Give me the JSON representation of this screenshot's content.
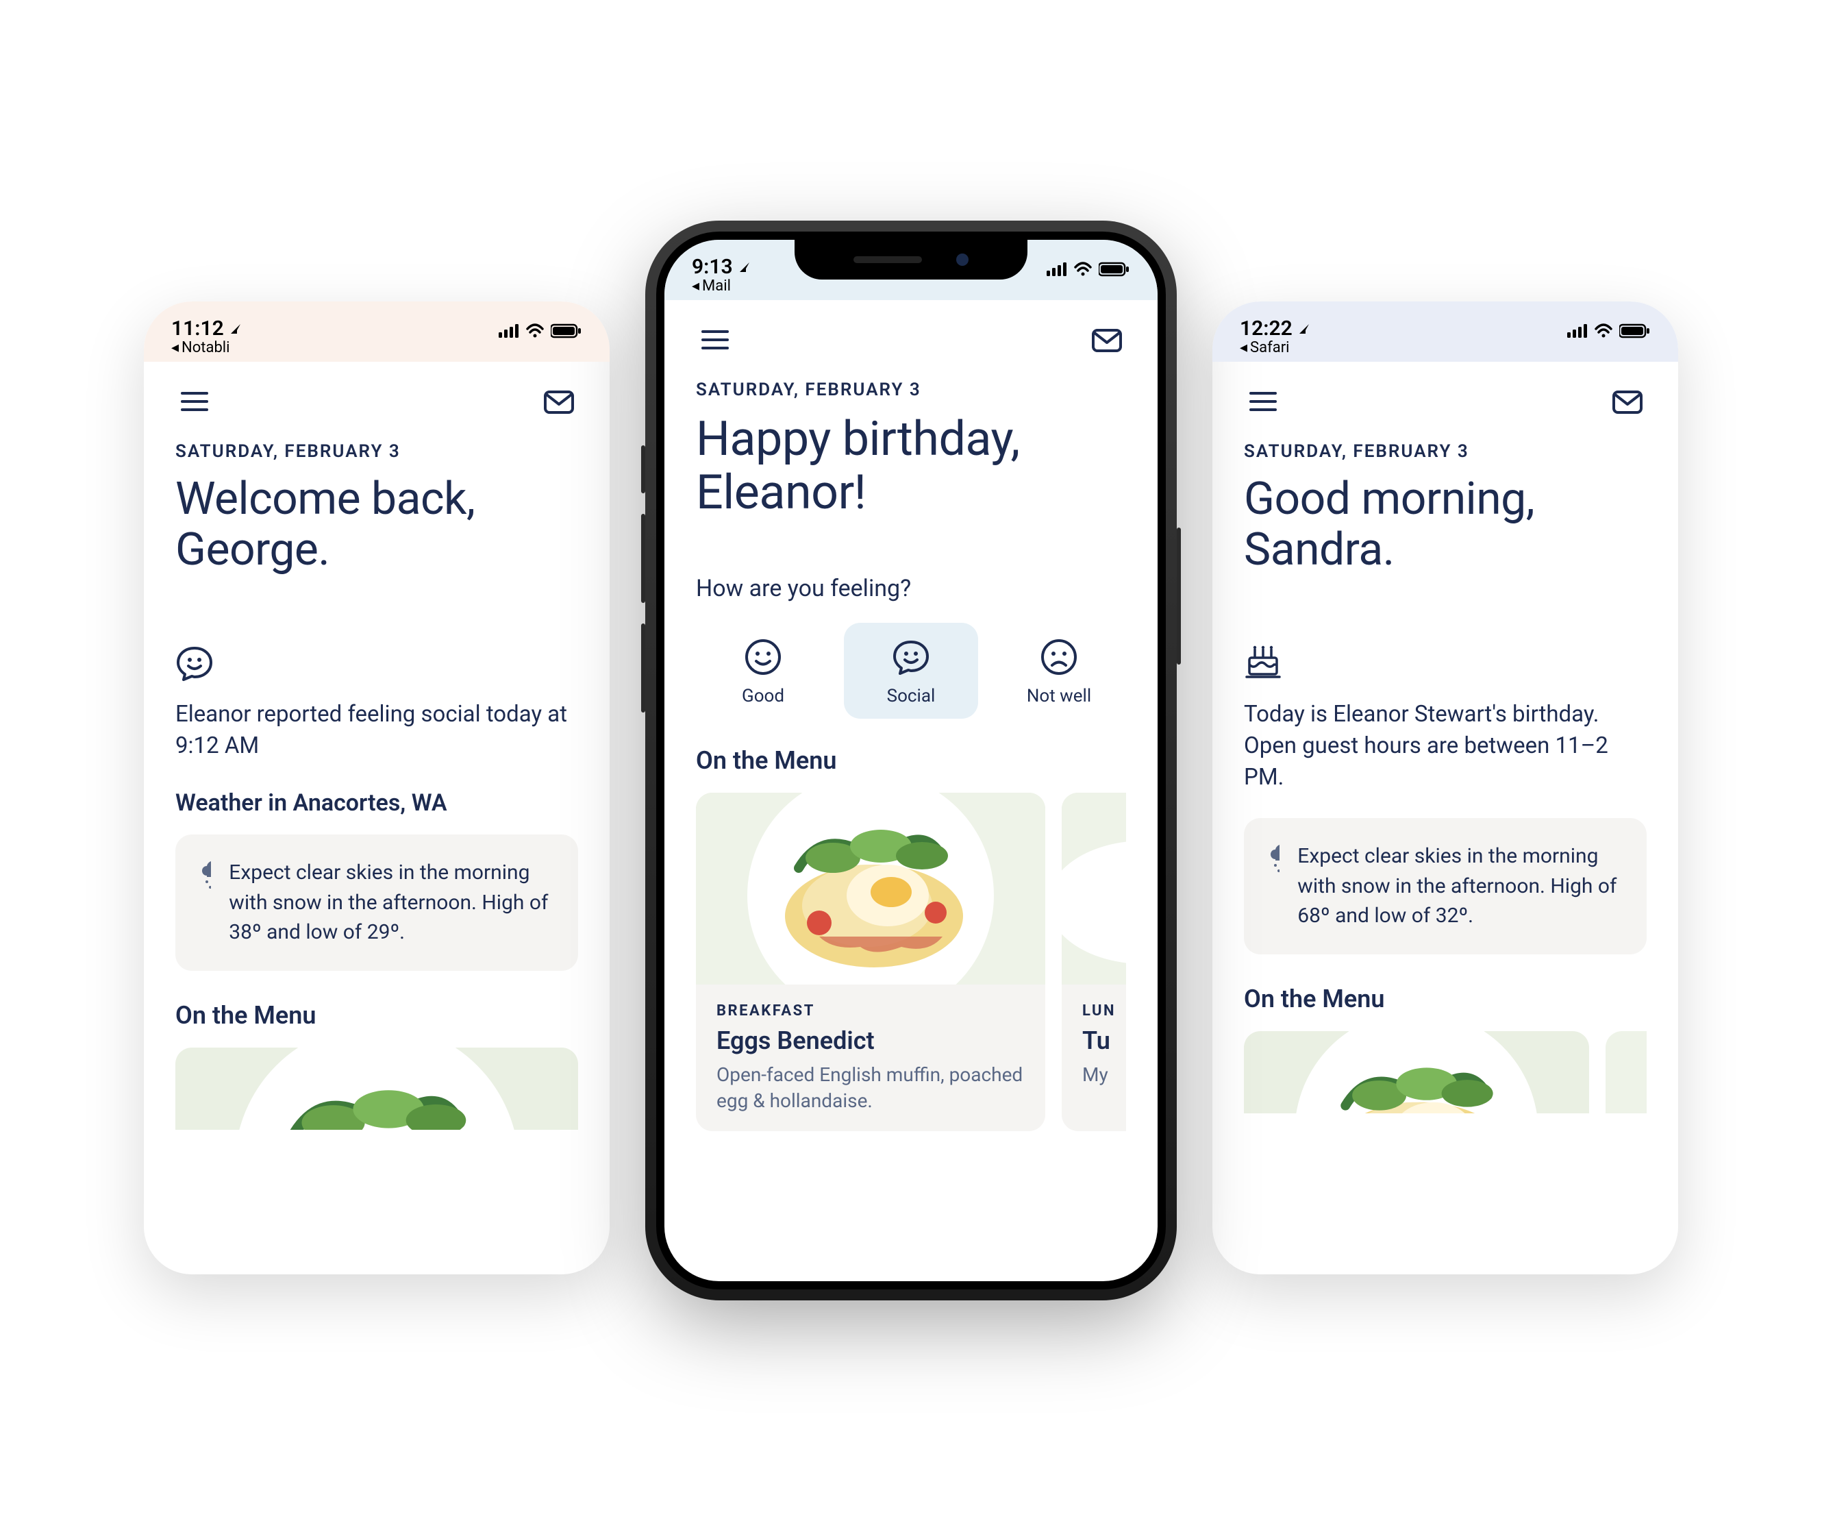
{
  "screens": {
    "left": {
      "status": {
        "time": "11:12",
        "back_app": "Notabli"
      },
      "header": {
        "bg_color": "#fbf1eb",
        "date": "SATURDAY, FEBRUARY 3",
        "greeting": "Welcome back, George."
      },
      "feeling_report": {
        "icon": "chat-smile-icon",
        "text": "Eleanor reported feeling social today at 9:12 AM"
      },
      "weather": {
        "title": "Weather in Anacortes, WA",
        "text": "Expect clear skies in the morning with snow in the afternoon. High of 38º and low of 29º."
      },
      "menu_title": "On the Menu"
    },
    "center": {
      "status": {
        "time": "9:13",
        "back_app": "Mail"
      },
      "header": {
        "bg_color": "#e6f0f6",
        "date": "SATURDAY, FEBRUARY 3",
        "greeting": "Happy birthday, Eleanor!"
      },
      "mood": {
        "question": "How are you feeling?",
        "options": [
          {
            "key": "good",
            "label": "Good",
            "icon": "smile-icon",
            "selected": false
          },
          {
            "key": "social",
            "label": "Social",
            "icon": "chat-smile-icon",
            "selected": true
          },
          {
            "key": "notwell",
            "label": "Not well",
            "icon": "frown-icon",
            "selected": false
          }
        ]
      },
      "menu": {
        "title": "On the Menu",
        "items": [
          {
            "tag": "BREAKFAST",
            "name": "Eggs Benedict",
            "desc": "Open-faced English muffin, poached egg & hollandaise."
          },
          {
            "tag": "LUN",
            "name": "Tu",
            "desc": "My"
          }
        ]
      }
    },
    "right": {
      "status": {
        "time": "12:22",
        "back_app": "Safari"
      },
      "header": {
        "bg_color": "#e9edf7",
        "date": "SATURDAY, FEBRUARY 3",
        "greeting": "Good morning, Sandra."
      },
      "birthday_notice": {
        "icon": "cake-icon",
        "text": "Today is Eleanor Stewart's birthday. Open guest hours are between 11–2 PM."
      },
      "weather": {
        "text": "Expect clear skies in the morning with snow in the afternoon. High of 68º and low of 32º."
      },
      "menu_title": "On the Menu"
    }
  },
  "colors": {
    "ink": "#1d2b50",
    "card_bg": "#f5f4f2",
    "selected_bg": "#e6f0f6"
  }
}
